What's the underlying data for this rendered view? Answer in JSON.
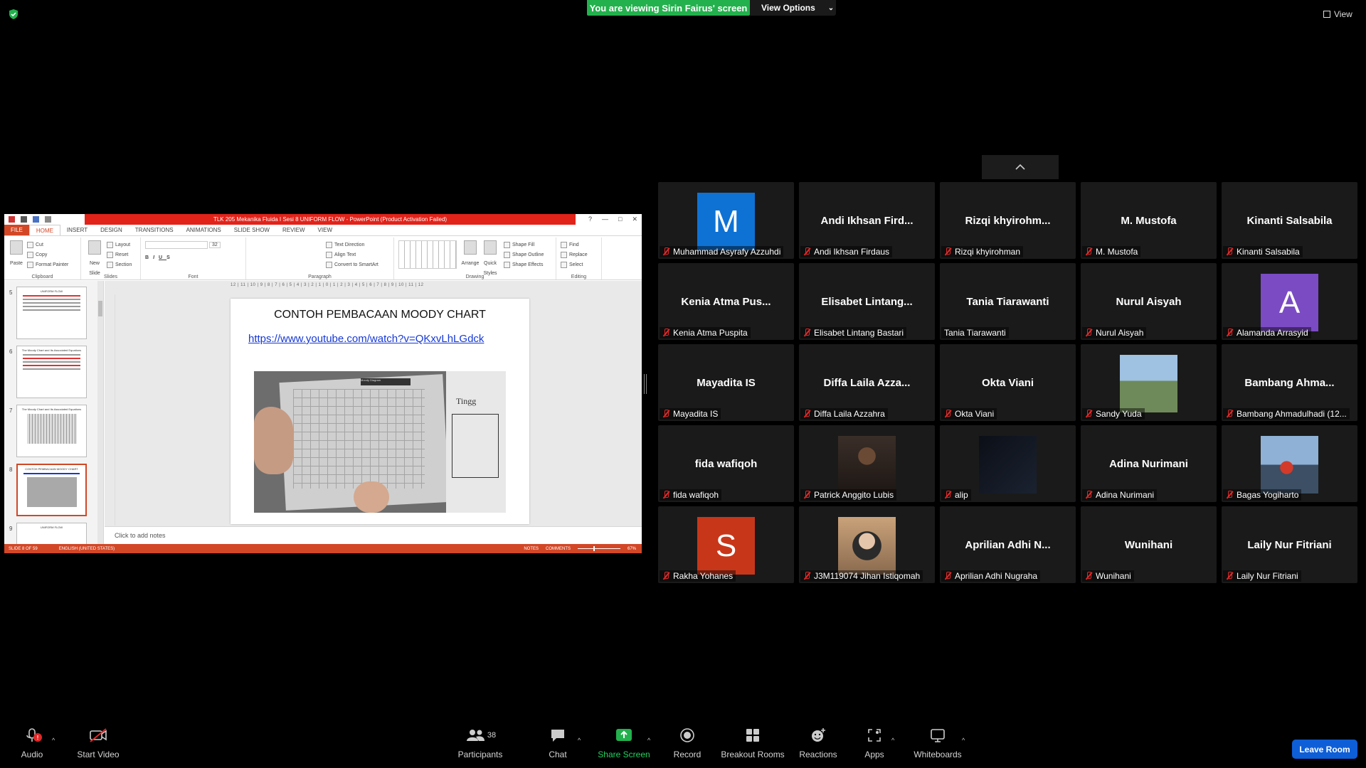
{
  "banner": {
    "viewing": "You are viewing Sirin Fairus' screen",
    "view_options": "View Options",
    "view": "View"
  },
  "ppt": {
    "title": "TLK 205 Mekanika Fluida I Sesi 8  UNIFORM FLOW -  PowerPoint (Product Activation Failed)",
    "tabs": [
      "FILE",
      "HOME",
      "INSERT",
      "DESIGN",
      "TRANSITIONS",
      "ANIMATIONS",
      "SLIDE SHOW",
      "REVIEW",
      "VIEW"
    ],
    "ribbon": {
      "clipboard": {
        "label": "Clipboard",
        "paste": "Paste",
        "cut": "Cut",
        "copy": "Copy",
        "format_painter": "Format Painter"
      },
      "slides": {
        "label": "Slides",
        "new_slide": "New Slide",
        "layout": "Layout",
        "reset": "Reset",
        "section": "Section"
      },
      "font": {
        "label": "Font",
        "size": "32"
      },
      "paragraph": {
        "label": "Paragraph",
        "text_direction": "Text Direction",
        "align_text": "Align Text",
        "convert": "Convert to SmartArt"
      },
      "drawing": {
        "label": "Drawing",
        "arrange": "Arrange",
        "quick_styles": "Quick Styles",
        "shape_fill": "Shape Fill",
        "shape_outline": "Shape Outline",
        "shape_effects": "Shape Effects"
      },
      "editing": {
        "label": "Editing",
        "find": "Find",
        "replace": "Replace",
        "select": "Select"
      }
    },
    "thumbnails": [
      {
        "num": "5",
        "title": "UNIFORM FLOW"
      },
      {
        "num": "6",
        "title": "The Moody Chart and Its Associated Equations"
      },
      {
        "num": "7",
        "title": "The Moody Chart and Its Associated Equations"
      },
      {
        "num": "8",
        "title": "CONTOH PEMBACAAN MOODY CHART"
      },
      {
        "num": "9",
        "title": "UNIFORM FLOW"
      }
    ],
    "ruler": "12 | 11 | 10 | 9 | 8 | 7 | 6 | 5 | 4 | 3 | 2 | 1 | 0 | 1 | 2 | 3 | 4 | 5 | 6 | 7 | 8 | 9 | 10 | 11 | 12",
    "slide": {
      "title": "CONTOH PEMBACAAN MOODY CHART",
      "link": "https://www.youtube.com/watch?v=QKxvLhLGdck",
      "photo_heading": "Tingg",
      "photo_caption": "Moody Diagram"
    },
    "notes_placeholder": "Click to add notes",
    "status": {
      "slide": "SLIDE 8 OF 59",
      "language": "ENGLISH (UNITED STATES)",
      "notes": "NOTES",
      "comments": "COMMENTS",
      "zoom": "67%"
    }
  },
  "participants": [
    {
      "name": "Muhammad Asyrafy Azzuhdi",
      "type": "avatar",
      "letter": "M",
      "color": "#0e72d5"
    },
    {
      "name": "Andi Ikhsan Firdaus",
      "type": "text",
      "display": "Andi Ikhsan Fird..."
    },
    {
      "name": "Rizqi khyirohman",
      "type": "text",
      "display": "Rizqi  khyirohm..."
    },
    {
      "name": "M. Mustofa",
      "type": "text",
      "display": "M. Mustofa"
    },
    {
      "name": "Kinanti Salsabila",
      "type": "text",
      "display": "Kinanti Salsabila"
    },
    {
      "name": "Kenia Atma Puspita",
      "type": "text",
      "display": "Kenia Atma Pus..."
    },
    {
      "name": "Elisabet Lintang Bastari",
      "type": "text",
      "display": "Elisabet  Lintang..."
    },
    {
      "name": "Tania Tiarawanti",
      "type": "text",
      "display": "Tania Tiarawanti",
      "nomic": true
    },
    {
      "name": "Nurul Aisyah",
      "type": "text",
      "display": "Nurul Aisyah"
    },
    {
      "name": "Alamanda Arrasyid",
      "type": "avatar",
      "letter": "A",
      "color": "#7b4bc4"
    },
    {
      "name": "Mayadita IS",
      "type": "text",
      "display": "Mayadita IS"
    },
    {
      "name": "Diffa Laila Azzahra",
      "type": "text",
      "display": "Diffa Laila Azza..."
    },
    {
      "name": "Okta Viani",
      "type": "text",
      "display": "Okta Viani"
    },
    {
      "name": "Sandy Yuda",
      "type": "photo",
      "photo": "sky"
    },
    {
      "name": "Bambang Ahmadulhadi (12...",
      "type": "text",
      "display": "Bambang  Ahma..."
    },
    {
      "name": "fida wafiqoh",
      "type": "text",
      "display": "fida wafiqoh"
    },
    {
      "name": "Patrick Anggito Lubis",
      "type": "photo",
      "photo": "dark-person"
    },
    {
      "name": "alip",
      "type": "photo",
      "photo": "night"
    },
    {
      "name": "Adina Nurimani",
      "type": "text",
      "display": "Adina Nurimani"
    },
    {
      "name": "Bagas Yogiharto",
      "type": "photo",
      "photo": "worker"
    },
    {
      "name": "Rakha Yohanes",
      "type": "avatar",
      "letter": "S",
      "color": "#c8361a"
    },
    {
      "name": "J3M119074 Jihan Istiqomah",
      "type": "photo",
      "photo": "hijab"
    },
    {
      "name": "Aprilian Adhi Nugraha",
      "type": "text",
      "display": "Aprilian  Adhi  N..."
    },
    {
      "name": "Wunihani",
      "type": "text",
      "display": "Wunihani"
    },
    {
      "name": "Laily Nur Fitriani",
      "type": "text",
      "display": "Laily Nur Fitriani"
    }
  ],
  "toolbar": {
    "audio": "Audio",
    "audio_badge": "!",
    "video": "Start Video",
    "participants": "Participants",
    "participants_count": "38",
    "chat": "Chat",
    "share": "Share Screen",
    "record": "Record",
    "breakout": "Breakout Rooms",
    "reactions": "Reactions",
    "apps": "Apps",
    "whiteboards": "Whiteboards",
    "leave": "Leave Room"
  },
  "colors": {
    "share_green": "#23b14d",
    "leave_blue": "#0e5ed7",
    "ppt_red": "#e2231a",
    "mute_red": "#e02828"
  }
}
